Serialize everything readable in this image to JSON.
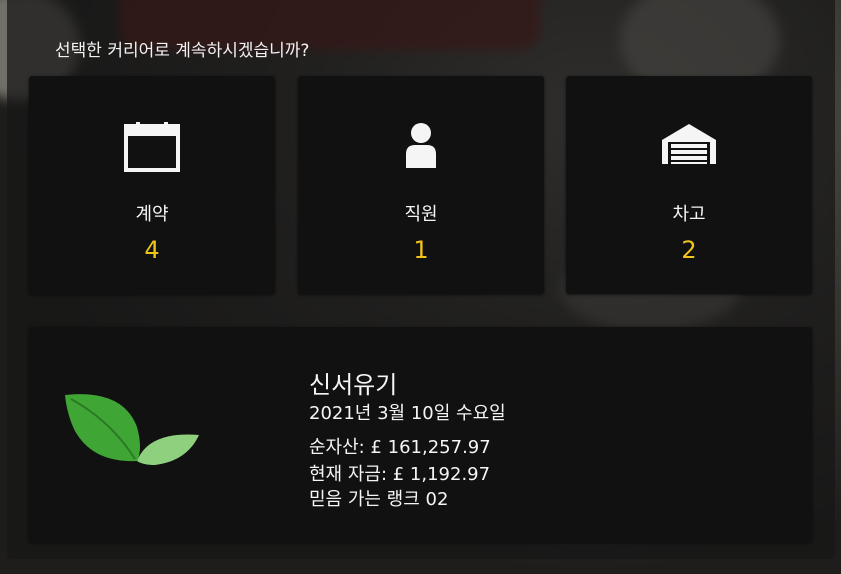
{
  "prompt": {
    "question": "선택한 커리어로 계속하시겠습니까?"
  },
  "stats": [
    {
      "label": "계약",
      "count": "4",
      "icon": "calendar-icon"
    },
    {
      "label": "직원",
      "count": "1",
      "icon": "person-icon"
    },
    {
      "label": "차고",
      "count": "2",
      "icon": "garage-icon"
    }
  ],
  "career": {
    "logo_icon": "leaf-icon",
    "name": "신서유기",
    "date": "2021년 3월 10일 수요일",
    "net_worth": "순자산: £ 161,257.97",
    "funds": "현재 자금: £ 1,192.97",
    "rank": "믿음 가는 랭크 02"
  },
  "colors": {
    "accent": "#f0c419",
    "panel": "#111111",
    "text": "#f5f5f5",
    "leaf_dark": "#3fa535",
    "leaf_light": "#8fd07e"
  }
}
